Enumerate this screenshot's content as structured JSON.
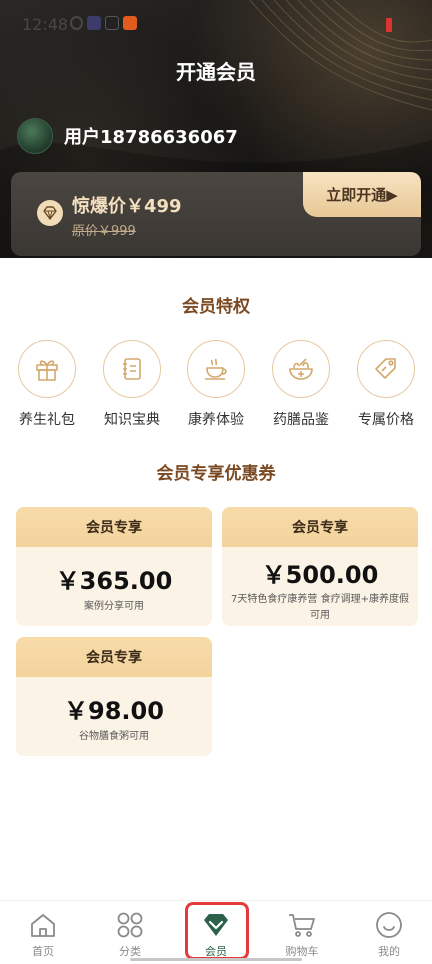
{
  "status_bar": {
    "time": "12:48"
  },
  "header": {
    "title": "开通会员",
    "user_name": "用户18786636067",
    "price_label": "惊爆价￥499",
    "original_price": "原价￥999",
    "open_button": "立即开通▶"
  },
  "privileges": {
    "title": "会员特权",
    "items": [
      {
        "label": "养生礼包",
        "icon": "gift-icon"
      },
      {
        "label": "知识宝典",
        "icon": "book-icon"
      },
      {
        "label": "康养体验",
        "icon": "teacup-icon"
      },
      {
        "label": "药膳品鉴",
        "icon": "herb-bowl-icon"
      },
      {
        "label": "专属价格",
        "icon": "price-tag-icon"
      }
    ]
  },
  "coupons": {
    "title": "会员专享优惠券",
    "items": [
      {
        "head": "会员专享",
        "amount": "￥365.00",
        "desc": "案例分享可用"
      },
      {
        "head": "会员专享",
        "amount": "￥500.00",
        "desc": "7天特色食疗康养营 食疗调理+康养度假可用"
      },
      {
        "head": "会员专享",
        "amount": "￥98.00",
        "desc": "谷物膳食粥可用"
      }
    ]
  },
  "tabbar": {
    "items": [
      {
        "label": "首页",
        "icon": "home-icon"
      },
      {
        "label": "分类",
        "icon": "category-icon"
      },
      {
        "label": "会员",
        "icon": "vip-gem-icon",
        "active": true
      },
      {
        "label": "购物车",
        "icon": "cart-icon"
      },
      {
        "label": "我的",
        "icon": "profile-icon"
      }
    ]
  },
  "colors": {
    "accent_brown": "#7b4a22",
    "gold": "#f3dfbf",
    "active_green": "#2a6148",
    "highlight_red": "#e43a3a"
  }
}
